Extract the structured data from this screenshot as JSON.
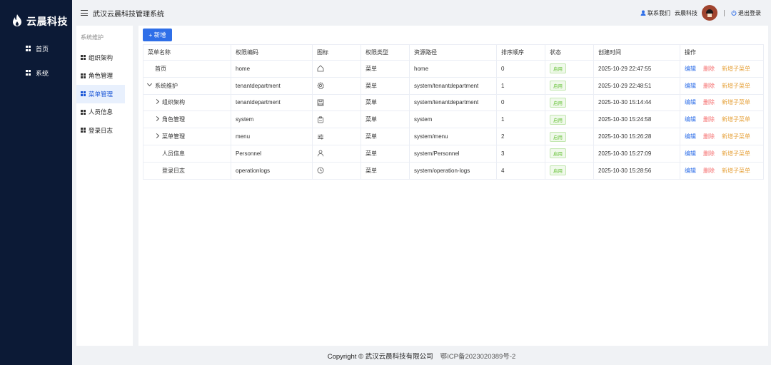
{
  "brand": {
    "name": "云晨科技"
  },
  "sidebar": {
    "items": [
      {
        "label": "首页"
      },
      {
        "label": "系统"
      }
    ]
  },
  "header": {
    "title": "武汉云晨科技管理系统",
    "contact_label": "联系我们",
    "company_label": "云晨科技",
    "logout_label": "退出登录"
  },
  "submenu": {
    "group_label": "系统维护",
    "items": [
      {
        "label": "组织架构"
      },
      {
        "label": "角色管理"
      },
      {
        "label": "菜单管理",
        "active": true
      },
      {
        "label": "人员信息"
      },
      {
        "label": "登录日志"
      }
    ]
  },
  "toolbar": {
    "add_label": "+ 新增"
  },
  "table": {
    "columns": [
      "菜单名称",
      "权限编码",
      "图标",
      "权限类型",
      "资源路径",
      "排序顺序",
      "状态",
      "创建时间",
      "操作"
    ],
    "rows": [
      {
        "name": "首页",
        "code": "home",
        "icon": "home-icon",
        "type": "菜单",
        "path": "home",
        "order": "0",
        "status": "启用",
        "created": "2025-10-29 22:47:55",
        "expand": "none",
        "indent": 0
      },
      {
        "name": "系统维护",
        "code": "tenantdepartment",
        "icon": "settings-icon",
        "type": "菜单",
        "path": "system/tenantdepartment",
        "order": "1",
        "status": "启用",
        "created": "2025-10-29 22:48:51",
        "expand": "open",
        "indent": 0
      },
      {
        "name": "组织架构",
        "code": "tenantdepartment",
        "icon": "save-icon",
        "type": "菜单",
        "path": "system/tenantdepartment",
        "order": "0",
        "status": "启用",
        "created": "2025-10-30 15:14:44",
        "expand": "closed",
        "indent": 1
      },
      {
        "name": "角色管理",
        "code": "system",
        "icon": "badge-icon",
        "type": "菜单",
        "path": "system",
        "order": "1",
        "status": "启用",
        "created": "2025-10-30 15:24:58",
        "expand": "closed",
        "indent": 1
      },
      {
        "name": "菜单管理",
        "code": "menu",
        "icon": "sliders-icon",
        "type": "菜单",
        "path": "system/menu",
        "order": "2",
        "status": "启用",
        "created": "2025-10-30 15:26:28",
        "expand": "closed",
        "indent": 1
      },
      {
        "name": "人员信息",
        "code": "Personnel",
        "icon": "user-icon",
        "type": "菜单",
        "path": "system/Personnel",
        "order": "3",
        "status": "启用",
        "created": "2025-10-30 15:27:09",
        "expand": "none",
        "indent": 1
      },
      {
        "name": "登录日志",
        "code": "operationlogs",
        "icon": "clock-icon",
        "type": "菜单",
        "path": "system/operation-logs",
        "order": "4",
        "status": "启用",
        "created": "2025-10-30 15:28:56",
        "expand": "none",
        "indent": 1
      }
    ],
    "actions": {
      "edit": "编辑",
      "delete": "删除",
      "add_child": "新增子菜单"
    }
  },
  "footer": {
    "copyright": "Copyright © 武汉云晨科技有限公司",
    "icp": "鄂ICP备2023020389号-2"
  },
  "colors": {
    "sidebar_bg": "#0c1a36",
    "primary": "#2f6fe8",
    "danger": "#f56c6c",
    "warning": "#e6a23c",
    "success": "#67c23a"
  }
}
